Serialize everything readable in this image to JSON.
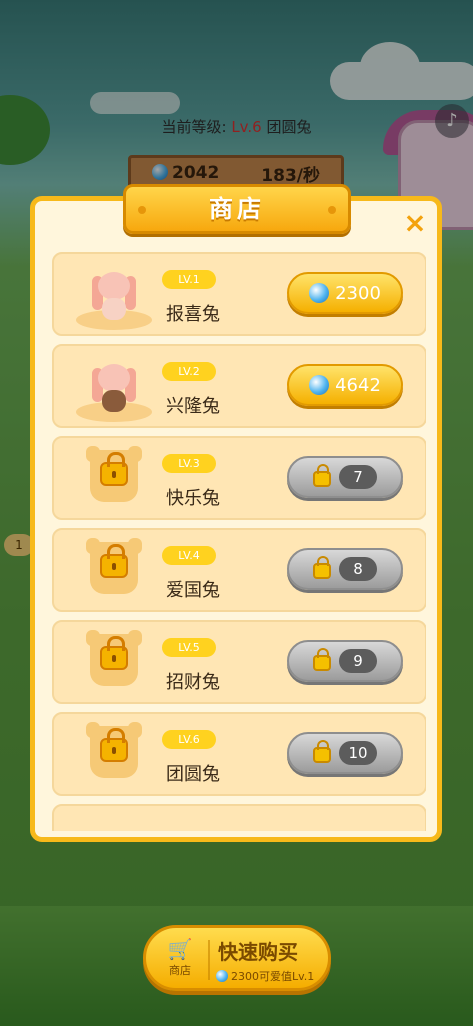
{
  "header": {
    "level_prefix": "当前等级: ",
    "level_value": "Lv.6",
    "level_name": " 团圆兔",
    "coins": "2042",
    "rate": "183/秒",
    "side_tag": "1"
  },
  "shop": {
    "title": "商店",
    "close_label": "×",
    "items": [
      {
        "lv": "LV.1",
        "name": "报喜兔",
        "price": "2300",
        "locked": false
      },
      {
        "lv": "LV.2",
        "name": "兴隆兔",
        "price": "4642",
        "locked": false
      },
      {
        "lv": "LV.3",
        "name": "快乐兔",
        "unlock_level": "7",
        "locked": true
      },
      {
        "lv": "LV.4",
        "name": "爱国兔",
        "unlock_level": "8",
        "locked": true
      },
      {
        "lv": "LV.5",
        "name": "招财兔",
        "unlock_level": "9",
        "locked": true
      },
      {
        "lv": "LV.6",
        "name": "团圆兔",
        "unlock_level": "10",
        "locked": true
      }
    ]
  },
  "bottom": {
    "shop_label": "商店",
    "quick_buy": "快速购买",
    "quick_buy_sub": "2300可爱值Lv.1"
  },
  "colors": {
    "accent": "#f7b91a",
    "level_red": "#dd3333"
  }
}
